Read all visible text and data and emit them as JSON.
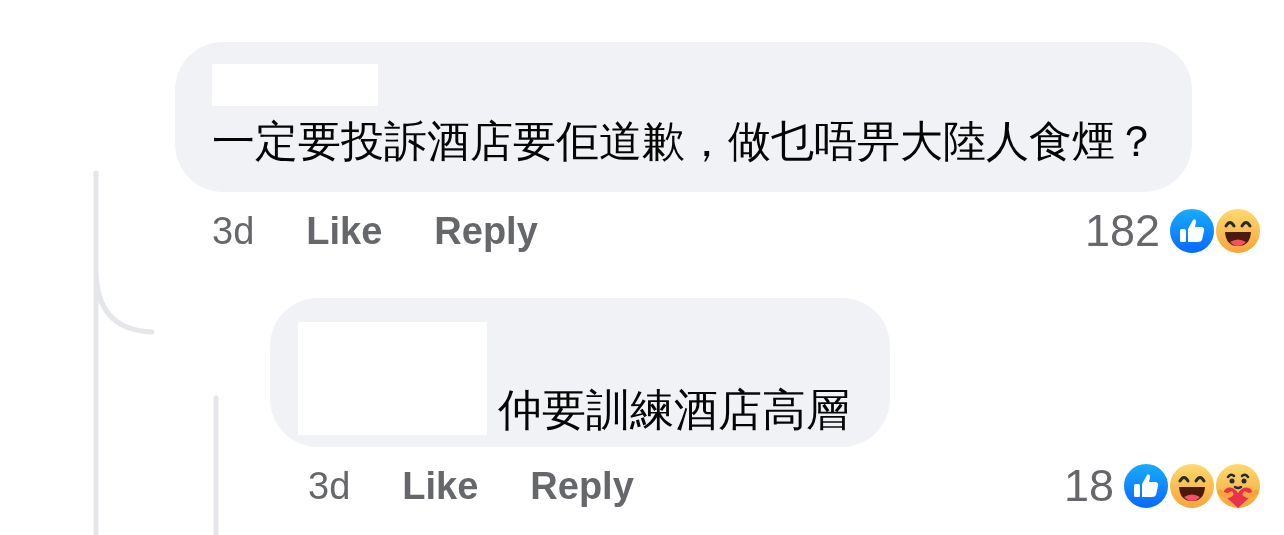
{
  "comments": [
    {
      "author": {
        "redacted": true
      },
      "text": "一定要投訴酒店要佢道歉，做乜唔畀大陸人食煙？",
      "time": "3d",
      "actions": [
        "Like",
        "Reply"
      ],
      "reaction_count": "182",
      "reactions": [
        {
          "kind": "like"
        },
        {
          "kind": "haha"
        }
      ],
      "replies": [
        {
          "author": {
            "redacted": true
          },
          "text": "仲要訓練酒店高層",
          "time": "3d",
          "actions": [
            "Like",
            "Reply"
          ],
          "reaction_count": "18",
          "reactions": [
            {
              "kind": "like"
            },
            {
              "kind": "haha"
            },
            {
              "kind": "care"
            }
          ]
        }
      ]
    }
  ]
}
